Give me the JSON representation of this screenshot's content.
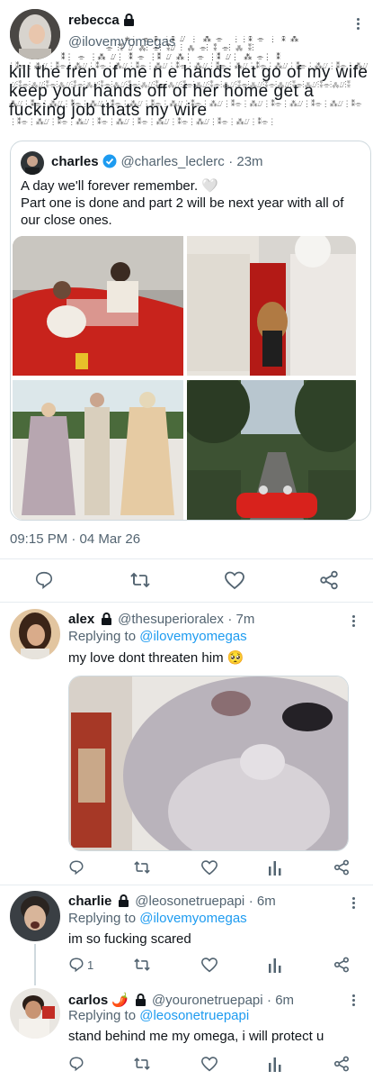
{
  "main_tweet": {
    "name": "rebecca",
    "handle": "@ilovemyomegas",
    "text": "kill the fren of me n e hands let go of my wife keep your hands off of her home get a fucking job thats my wire",
    "timestamp": "09:15 PM · 04 Mar 26"
  },
  "quoted_tweet": {
    "name": "charles",
    "handle": "@charles_leclerc",
    "time": "23m",
    "line1": "A day we'll forever remember. 🤍",
    "line2": "Part one is done and part 2 will be next year with all of our close ones."
  },
  "replies": [
    {
      "name": "alex",
      "handle": "@thesuperioralex",
      "time": "7m",
      "replying_label": "Replying to",
      "replying_to": "@ilovemyomegas",
      "text": "my love dont threaten him 🥺"
    },
    {
      "name": "charlie",
      "handle": "@leosonetruepapi",
      "time": "6m",
      "replying_label": "Replying to",
      "replying_to": "@ilovemyomegas",
      "text": "im so fucking scared",
      "reply_count": "1"
    },
    {
      "name": "carlos 🌶️",
      "handle": "@youronetruepapi",
      "time": "6m",
      "replying_label": "Replying to",
      "replying_to": "@leosonetruepapi",
      "text": "stand behind me my omega, i will protect u"
    }
  ],
  "colors": {
    "accent": "#1d9bf0",
    "text": "#0f1419",
    "muted": "#536471",
    "verified": "#1d9bf0"
  },
  "icons": [
    "lock-icon",
    "more-icon",
    "verified-icon",
    "reply-icon",
    "retweet-icon",
    "like-icon",
    "share-icon",
    "analytics-icon"
  ]
}
